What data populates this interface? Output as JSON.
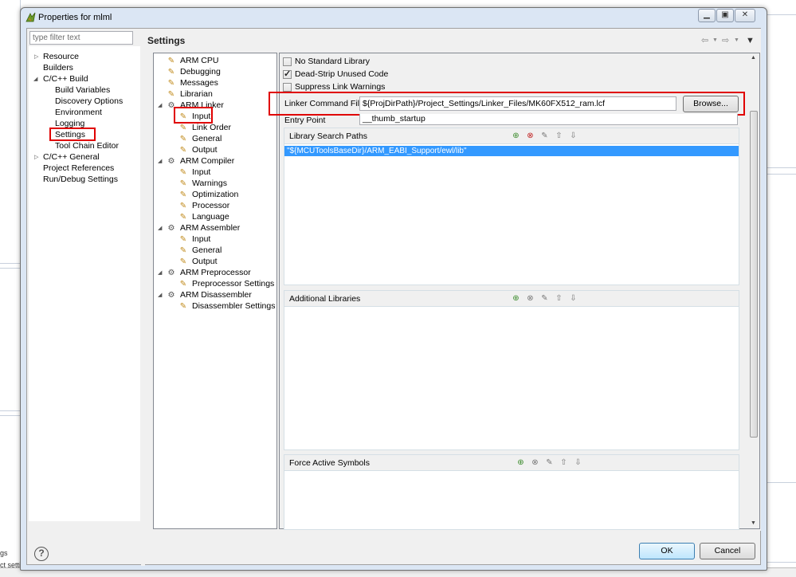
{
  "window": {
    "title": "Properties for mlml"
  },
  "filter": {
    "placeholder": "type filter text"
  },
  "left_tree": {
    "resource": "Resource",
    "builders": "Builders",
    "cpp_build": "C/C++ Build",
    "build_variables": "Build Variables",
    "discovery_options": "Discovery Options",
    "environment": "Environment",
    "logging": "Logging",
    "settings": "Settings",
    "tool_chain_editor": "Tool Chain Editor",
    "cpp_general": "C/C++ General",
    "project_references": "Project References",
    "run_debug_settings": "Run/Debug Settings"
  },
  "page": {
    "title": "Settings"
  },
  "tool_tree": {
    "arm_cpu": "ARM CPU",
    "debugging": "Debugging",
    "messages": "Messages",
    "librarian": "Librarian",
    "arm_linker": "ARM Linker",
    "linker_input": "Input",
    "link_order": "Link Order",
    "linker_general": "General",
    "linker_output": "Output",
    "arm_compiler": "ARM Compiler",
    "compiler_input": "Input",
    "warnings": "Warnings",
    "optimization": "Optimization",
    "processor": "Processor",
    "language": "Language",
    "arm_assembler": "ARM Assembler",
    "assembler_input": "Input",
    "assembler_general": "General",
    "assembler_output": "Output",
    "arm_preprocessor": "ARM Preprocessor",
    "preprocessor_settings": "Preprocessor Settings",
    "arm_disassembler": "ARM Disassembler",
    "disassembler_settings": "Disassembler Settings"
  },
  "settings_pane": {
    "no_standard_library": {
      "label": "No Standard Library",
      "checked": false
    },
    "dead_strip": {
      "label": "Dead-Strip Unused Code",
      "checked": true
    },
    "suppress_warnings": {
      "label": "Suppress Link Warnings",
      "checked": false
    },
    "linker_command_file_label": "Linker Command File",
    "linker_command_file_value": "${ProjDirPath}/Project_Settings/Linker_Files/MK60FX512_ram.lcf",
    "browse_label": "Browse...",
    "entry_point_label": "Entry Point",
    "entry_point_value": "__thumb_startup",
    "library_search_paths_label": "Library Search Paths",
    "library_search_paths": [
      "\"${MCUToolsBaseDir}/ARM_EABI_Support/ewl/lib\""
    ],
    "additional_libraries_label": "Additional Libraries",
    "force_active_symbols_label": "Force Active Symbols"
  },
  "footer": {
    "ok_label": "OK",
    "cancel_label": "Cancel"
  },
  "background": {
    "snippet_1": "gs",
    "snippet_2": "ct setti"
  },
  "colors": {
    "highlight": "#e00000",
    "selection": "#3399ff",
    "dialog_frame": "#dbe6f4"
  }
}
